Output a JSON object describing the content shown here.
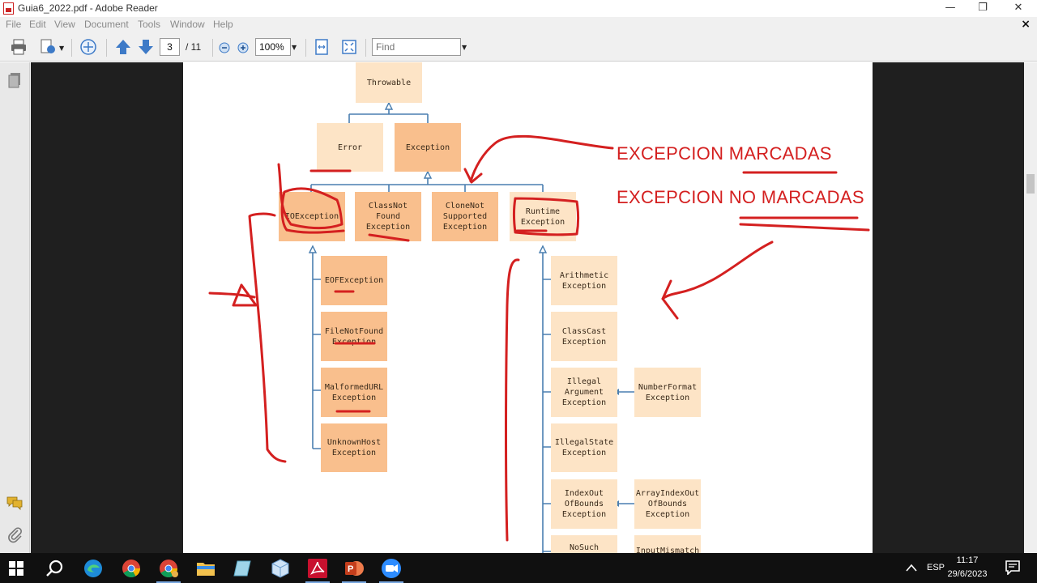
{
  "window": {
    "title": "Guia6_2022.pdf - Adobe Reader",
    "min_glyph": "—",
    "restore_glyph": "❐",
    "close_glyph": "✕"
  },
  "menu": {
    "items": [
      "File",
      "Edit",
      "View",
      "Document",
      "Tools",
      "Window",
      "Help"
    ],
    "doc_close": "×"
  },
  "toolbar": {
    "page_current": "3",
    "page_total": "/ 11",
    "zoom": "100%",
    "find_placeholder": "Find"
  },
  "diagram": {
    "throwable": "Throwable",
    "error": "Error",
    "exception": "Exception",
    "ioexception": "IOException",
    "classnotfound": "ClassNot\nFound\nException",
    "clonenotsupported": "CloneNot\nSupported\nException",
    "runtime": "Runtime\nException",
    "eof": "EOFException",
    "filenotfound": "FileNotFound\nException",
    "malformedurl": "MalformedURL\nException",
    "unknownhost": "UnknownHost\nException",
    "arithmetic": "Arithmetic\nException",
    "classcast": "ClassCast\nException",
    "illegalargument": "Illegal\nArgument\nException",
    "numberformat": "NumberFormat\nException",
    "illegalstate": "IllegalState\nException",
    "indexout": "IndexOut\nOfBounds\nException",
    "arrayindexout": "ArrayIndexOut\nOfBounds\nException",
    "nosuch": "NoSuch",
    "inputmismatch": "InputMismatch"
  },
  "annotations": {
    "checked": "EXCEPCION MARCADAS",
    "unchecked": "EXCEPCION NO MARCADAS"
  },
  "taskbar": {
    "lang": "ESP",
    "time": "11:17",
    "date": "29/6/2023"
  },
  "colors": {
    "box_light": "#fde4c6",
    "box_dark": "#f9bf8d",
    "connector": "#4a7fb0",
    "annotation": "#d42020"
  }
}
